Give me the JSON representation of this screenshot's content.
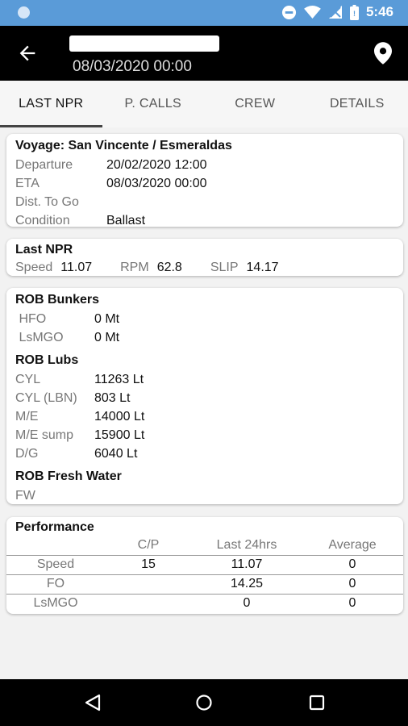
{
  "status_bar": {
    "time": "5:46",
    "icons": [
      "notification-dot-icon",
      "do-not-disturb-icon",
      "wifi-icon",
      "no-signal-icon",
      "battery-icon"
    ]
  },
  "app_bar": {
    "subtitle": "08/03/2020 00:00"
  },
  "tabs": [
    {
      "label": "LAST NPR",
      "active": true
    },
    {
      "label": "P. CALLS",
      "active": false
    },
    {
      "label": "CREW",
      "active": false
    },
    {
      "label": "DETAILS",
      "active": false
    }
  ],
  "voyage": {
    "title": "Voyage: San Vincente / Esmeraldas",
    "rows": [
      {
        "label": "Departure",
        "value": "20/02/2020 12:00"
      },
      {
        "label": "ETA",
        "value": "08/03/2020 00:00"
      },
      {
        "label": "Dist. To Go",
        "value": ""
      },
      {
        "label": "Condition",
        "value": "Ballast"
      }
    ]
  },
  "last_npr": {
    "title": "Last NPR",
    "speed_label": "Speed",
    "speed_value": "11.07",
    "rpm_label": "RPM",
    "rpm_value": "62.8",
    "slip_label": "SLIP",
    "slip_value": "14.17"
  },
  "rob": {
    "bunkers_title": "ROB Bunkers",
    "bunkers": [
      {
        "label": " HFO",
        "value": "0 Mt"
      },
      {
        "label": " LsMGO",
        "value": "0 Mt"
      }
    ],
    "lubs_title": "ROB Lubs",
    "lubs": [
      {
        "label": "CYL",
        "value": "11263 Lt"
      },
      {
        "label": "CYL (LBN)",
        "value": "803 Lt"
      },
      {
        "label": "M/E",
        "value": "14000 Lt"
      },
      {
        "label": "M/E sump",
        "value": "15900 Lt"
      },
      {
        "label": "D/G",
        "value": "6040 Lt"
      }
    ],
    "water_title": "ROB Fresh Water",
    "water": [
      {
        "label": "FW",
        "value": ""
      }
    ]
  },
  "performance": {
    "title": "Performance",
    "headers": [
      "",
      "C/P",
      "Last 24hrs",
      "Average"
    ],
    "rows": [
      {
        "label": "Speed",
        "cp": "15",
        "last24": "11.07",
        "average": "0"
      },
      {
        "label": "FO",
        "cp": "",
        "last24": "14.25",
        "average": "0"
      },
      {
        "label": "LsMGO",
        "cp": "",
        "last24": "0",
        "average": "0"
      }
    ]
  },
  "nav_bar": {
    "buttons": [
      "back-triangle-icon",
      "home-circle-icon",
      "recents-square-icon"
    ]
  },
  "colors": {
    "status_bar": "#5a9bd8",
    "app_bar": "#000000",
    "background": "#f2f2f2"
  }
}
